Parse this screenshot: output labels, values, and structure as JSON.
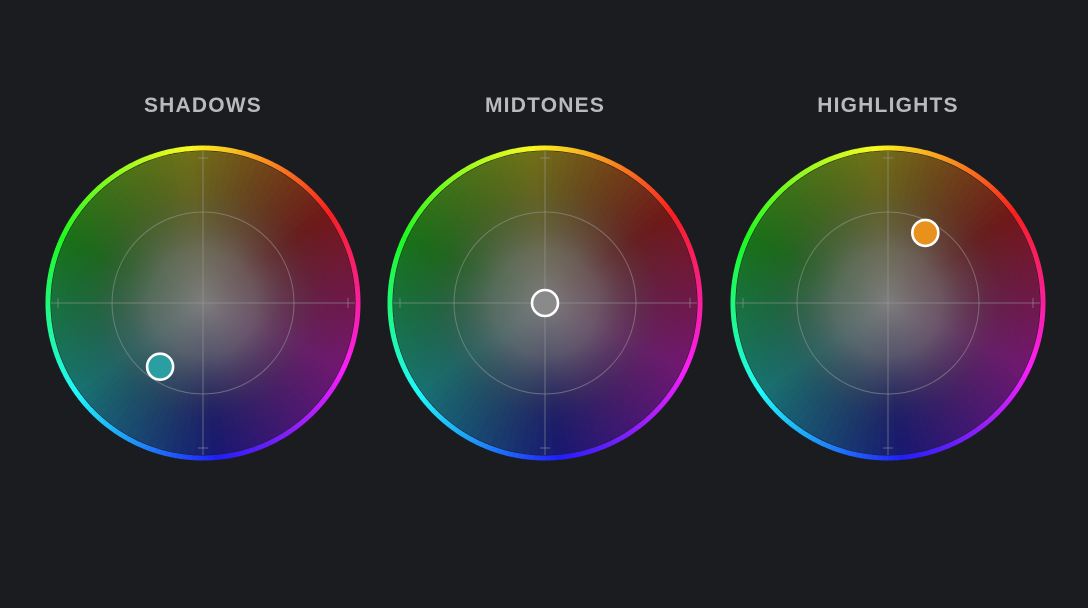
{
  "wheels": [
    {
      "id": "shadows",
      "title": "SHADOWS",
      "puck": {
        "angle_deg": 214,
        "magnitude": 0.6,
        "color": "#2a9ea0"
      }
    },
    {
      "id": "midtones",
      "title": "MIDTONES",
      "puck": {
        "angle_deg": 0,
        "magnitude": 0.0,
        "color": "#8a8a8a"
      }
    },
    {
      "id": "highlights",
      "title": "HIGHLIGHTS",
      "puck": {
        "angle_deg": 28,
        "magnitude": 0.62,
        "color": "#e8911c"
      }
    }
  ],
  "colors": {
    "background": "#1b1c1f",
    "title": "#b9babd",
    "puck_border": "#ffffff",
    "guide_lines": "#9a9a9a"
  }
}
